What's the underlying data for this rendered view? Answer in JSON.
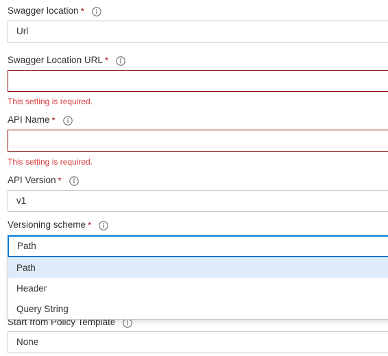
{
  "form": {
    "fields": [
      {
        "id": "swagger-location",
        "label": "Swagger location",
        "required": true,
        "info": "info-icon",
        "value": "Url",
        "state": "normal",
        "error": null
      },
      {
        "id": "swagger-location-url",
        "label": "Swagger Location URL",
        "required": true,
        "info": "info-icon",
        "value": "",
        "state": "error",
        "error": "This setting is required."
      },
      {
        "id": "api-name",
        "label": "API Name",
        "required": true,
        "info": "info-icon",
        "value": "",
        "state": "error",
        "error": "This setting is required."
      },
      {
        "id": "api-version",
        "label": "API Version",
        "required": true,
        "info": "info-icon",
        "value": "v1",
        "state": "normal",
        "error": null
      },
      {
        "id": "versioning-scheme",
        "label": "Versioning scheme",
        "required": true,
        "info": "info-icon",
        "value": "Path",
        "state": "focused",
        "error": null
      },
      {
        "id": "start-from-policy-template",
        "label": "Start from Policy Template",
        "required": false,
        "info": "info-icon",
        "value": "None",
        "state": "normal",
        "error": null
      }
    ],
    "required_marker": "*",
    "dropdown": {
      "open": true,
      "owner": "versioning-scheme",
      "selected": "Path",
      "options": [
        {
          "label": "Path",
          "selected": true
        },
        {
          "label": "Header",
          "selected": false
        },
        {
          "label": "Query String",
          "selected": false
        }
      ]
    }
  },
  "colors": {
    "accent": "#0078d4",
    "error_border": "#8b0000",
    "error_text": "#d93b3b",
    "required_star": "#a4262c",
    "field_border": "#c8c6c4",
    "option_selected_bg": "#deecf9",
    "text": "#323130"
  }
}
